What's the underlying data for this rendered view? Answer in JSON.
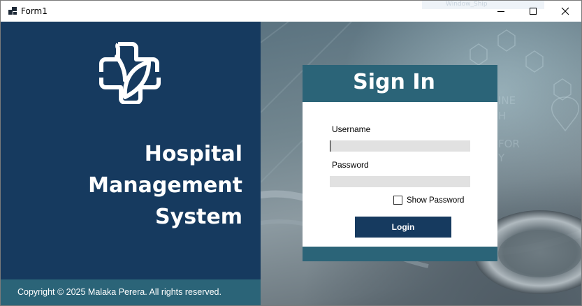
{
  "window": {
    "title": "Form1",
    "background_tab_text": "Window_Ship"
  },
  "branding": {
    "title_line1": "Hospital",
    "title_line2": "Management",
    "title_line3": "System",
    "copyright": "Copyright © 2025 Malaka Perera. All rights reserved."
  },
  "signin": {
    "heading": "Sign In",
    "username_label": "Username",
    "username_value": "",
    "password_label": "Password",
    "password_value": "",
    "show_password_label": "Show Password",
    "show_password_checked": false,
    "login_label": "Login"
  },
  "colors": {
    "primary_navy": "#163a5f",
    "accent_teal": "#2b6478",
    "input_gray": "#e1e1e1"
  },
  "icons": [
    "app-icon",
    "minimize-icon",
    "maximize-icon",
    "close-icon",
    "medical-cross-logo-icon"
  ]
}
